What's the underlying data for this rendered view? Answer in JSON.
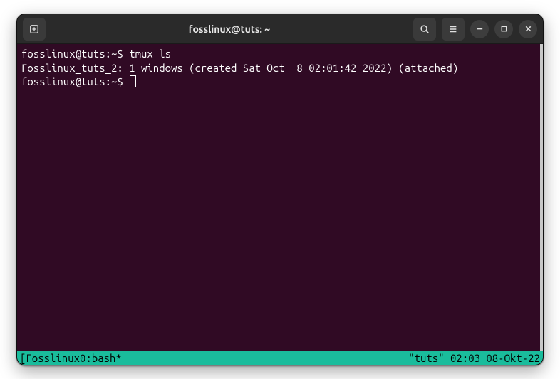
{
  "titlebar": {
    "title": "fosslinux@tuts: ~"
  },
  "terminal": {
    "prompt1": "fosslinux@tuts:~$ ",
    "command1": "tmux ls",
    "output_prefix": "Fosslinux_tuts_2: ",
    "output_count": "1",
    "output_suffix": " windows (created Sat Oct  8 02:01:42 2022) (attached)",
    "prompt2": "fosslinux@tuts:~$ "
  },
  "statusbar": {
    "left": "[Fosslinux0:bash*",
    "right": "\"tuts\" 02:03 08-Okt-22"
  }
}
